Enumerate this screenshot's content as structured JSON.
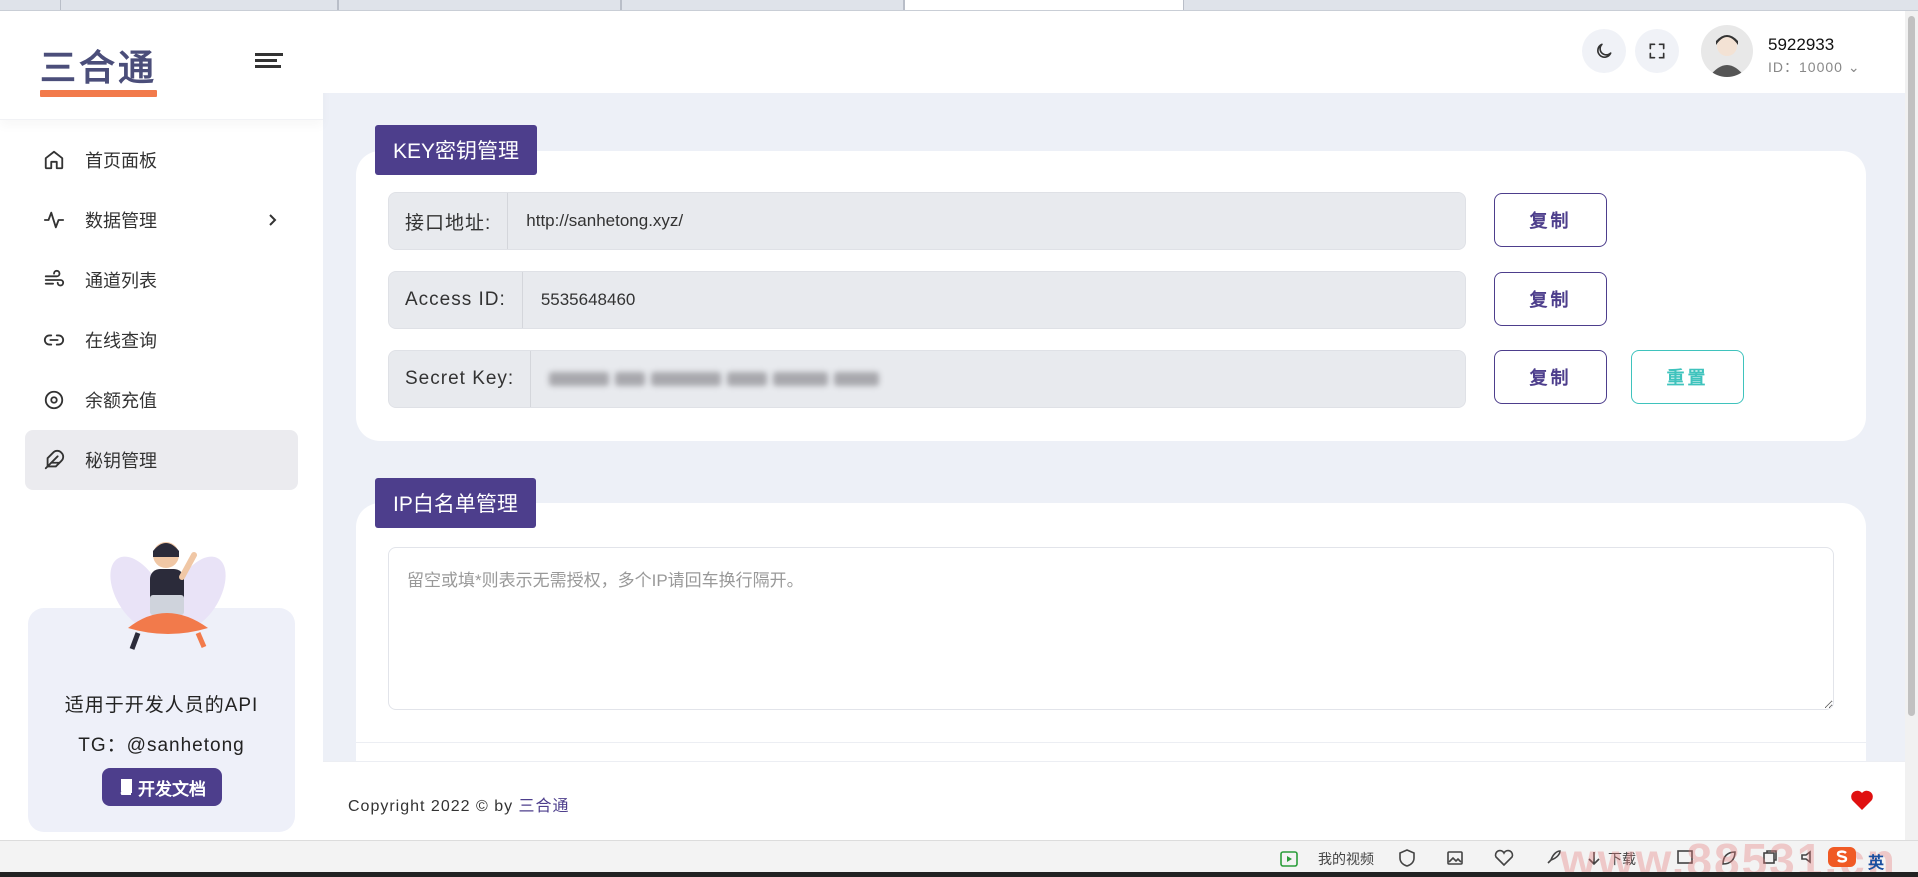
{
  "app": {
    "logo_text": "三合通"
  },
  "sidebar": {
    "items": [
      {
        "label": "首页面板",
        "icon": "home-icon"
      },
      {
        "label": "数据管理",
        "icon": "activity-icon",
        "has_children": true
      },
      {
        "label": "通道列表",
        "icon": "wind-icon"
      },
      {
        "label": "在线查询",
        "icon": "link-icon"
      },
      {
        "label": "余额充值",
        "icon": "target-icon"
      },
      {
        "label": "秘钥管理",
        "icon": "feather-icon",
        "active": true
      }
    ],
    "promo": {
      "line1": "适用于开发人员的API",
      "line2": "TG：@sanhetong",
      "button": "开发文档"
    }
  },
  "header": {
    "user_name": "5922933",
    "user_id": "ID：10000"
  },
  "key_card": {
    "title": "KEY密钥管理",
    "rows": [
      {
        "label": "接口地址:",
        "value": "http://sanhetong.xyz/"
      },
      {
        "label": "Access ID:",
        "value": "5535648460"
      },
      {
        "label": "Secret Key:",
        "value": ""
      }
    ],
    "copy_label": "复制",
    "reset_label": "重置"
  },
  "ip_card": {
    "title": "IP白名单管理",
    "placeholder": "留空或填*则表示无需授权，多个IP请回车换行隔开。",
    "value": ""
  },
  "footer": {
    "copyright": "Copyright 2022 © by",
    "brand": "三合通"
  },
  "statusbar": {
    "video": "我的视频",
    "download": "下载",
    "ime": "英",
    "watermark": "www.88531.cn"
  },
  "colors": {
    "primary": "#4d3e8c",
    "accent_teal": "#3fc3bd",
    "logo_orange": "#f27a4b",
    "heart": "#e01010"
  }
}
